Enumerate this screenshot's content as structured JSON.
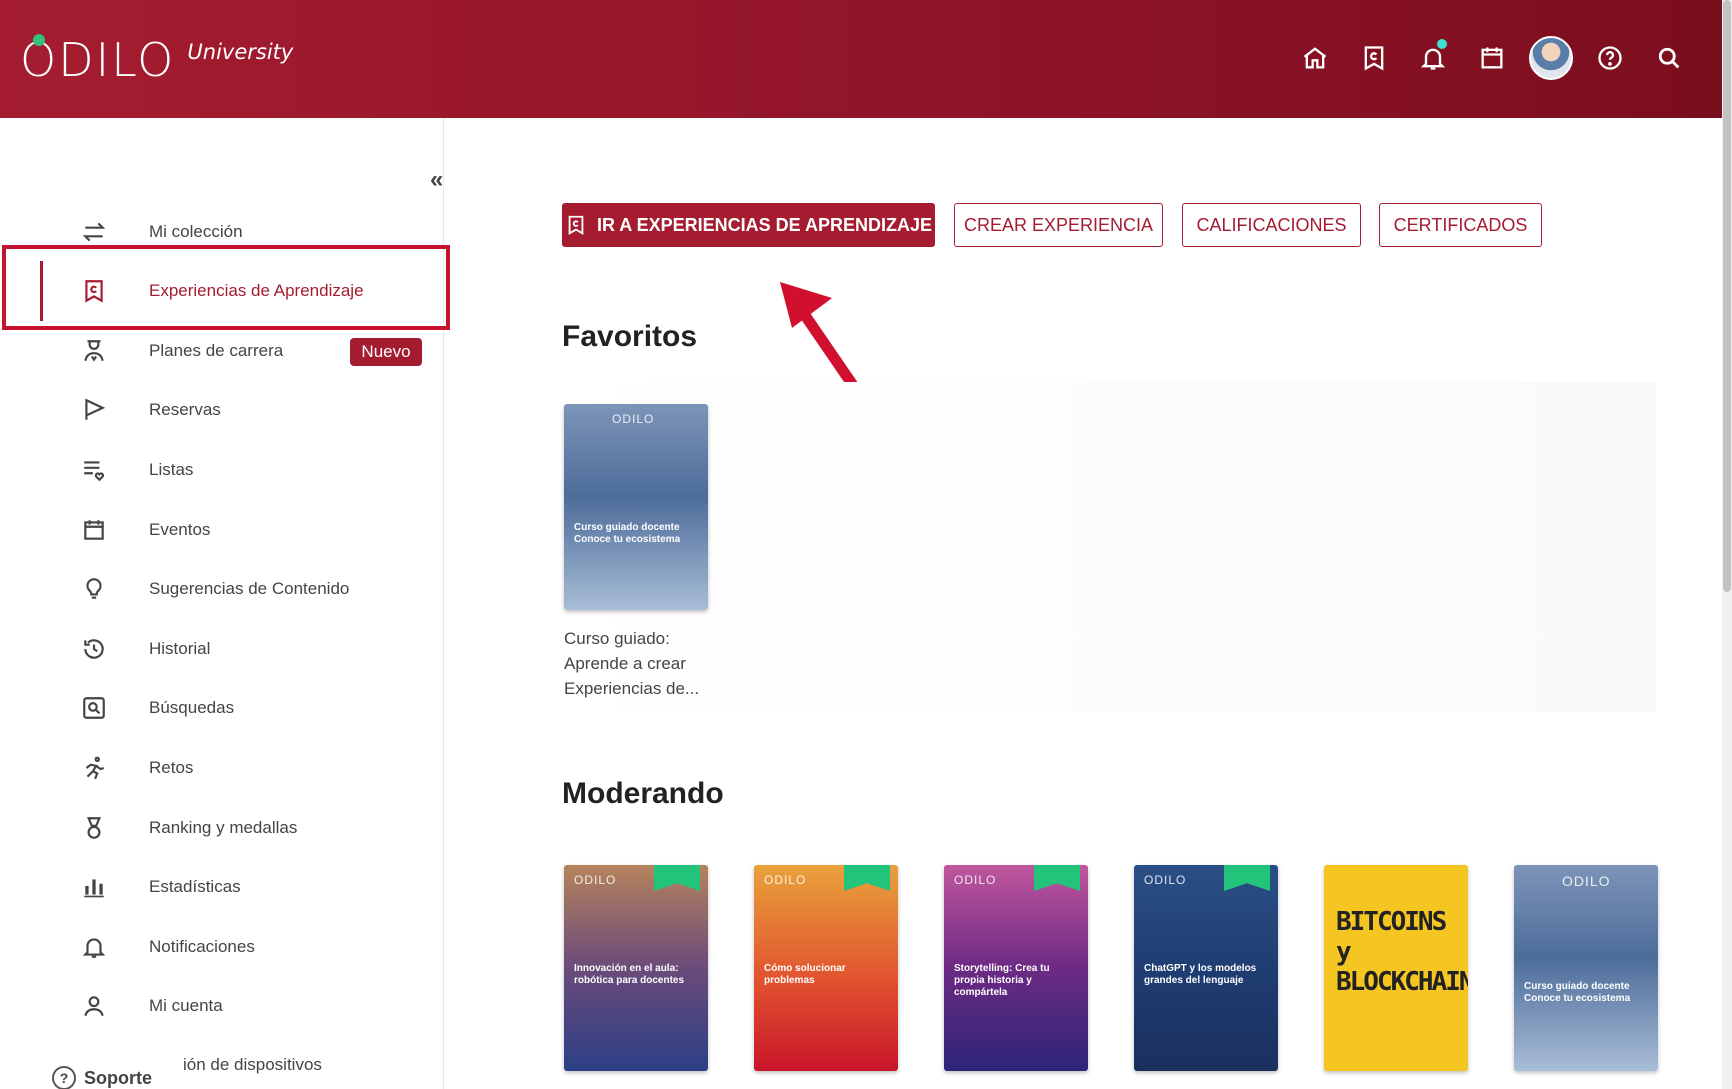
{
  "header": {
    "logo_text": "ODILO",
    "logo_sub": "University",
    "icons": [
      "home-icon",
      "learning-experience-icon",
      "bell-icon",
      "calendar-icon",
      "avatar",
      "help-icon",
      "search-icon"
    ]
  },
  "sidebar": {
    "collapse_label": "«",
    "items": [
      {
        "label": "Mi colección",
        "icon": "swap-arrows-icon"
      },
      {
        "label": "Experiencias de Aprendizaje",
        "icon": "learning-experience-icon",
        "active": true
      },
      {
        "label": "Planes de carrera",
        "icon": "career-icon",
        "badge": "Nuevo"
      },
      {
        "label": "Reservas",
        "icon": "flag-icon"
      },
      {
        "label": "Listas",
        "icon": "list-heart-icon"
      },
      {
        "label": "Eventos",
        "icon": "calendar-icon"
      },
      {
        "label": "Sugerencias de Contenido",
        "icon": "lightbulb-icon"
      },
      {
        "label": "Historial",
        "icon": "history-icon"
      },
      {
        "label": "Búsquedas",
        "icon": "search-box-icon"
      },
      {
        "label": "Retos",
        "icon": "runner-icon"
      },
      {
        "label": "Ranking y medallas",
        "icon": "medal-icon"
      },
      {
        "label": "Estadísticas",
        "icon": "bar-chart-icon"
      },
      {
        "label": "Notificaciones",
        "icon": "bell-icon"
      },
      {
        "label": "Mi cuenta",
        "icon": "user-icon"
      },
      {
        "label": "ión de dispositivos",
        "icon": ""
      }
    ],
    "support_label": "Soporte"
  },
  "actions": {
    "primary": "IR A EXPERIENCIAS DE APRENDIZAJE",
    "create": "CREAR EXPERIENCIA",
    "grades": "CALIFICACIONES",
    "certificates": "CERTIFICADOS"
  },
  "favorites": {
    "title": "Favoritos",
    "items": [
      {
        "brand": "ODILO",
        "cover_text": "Curso guiado docente\nConoce tu ecosistema",
        "caption": "Curso guiado: Aprende a crear Experiencias de..."
      }
    ]
  },
  "moderating": {
    "title": "Moderando",
    "items": [
      {
        "brand": "ODILO",
        "cover_text": "Innovación en el aula: robótica para docentes"
      },
      {
        "brand": "ODILO",
        "cover_text": "Cómo solucionar problemas"
      },
      {
        "brand": "ODILO",
        "cover_text": "Storytelling: Crea tu propia historia y compártela"
      },
      {
        "brand": "ODILO",
        "cover_text": "ChatGPT y los modelos grandes del lenguaje"
      },
      {
        "brand": "",
        "cover_text": "BITCOINS y BLOCKCHAINS"
      },
      {
        "brand": "ODILO",
        "cover_text": "Curso guiado docente\nConoce tu ecosistema"
      }
    ]
  }
}
